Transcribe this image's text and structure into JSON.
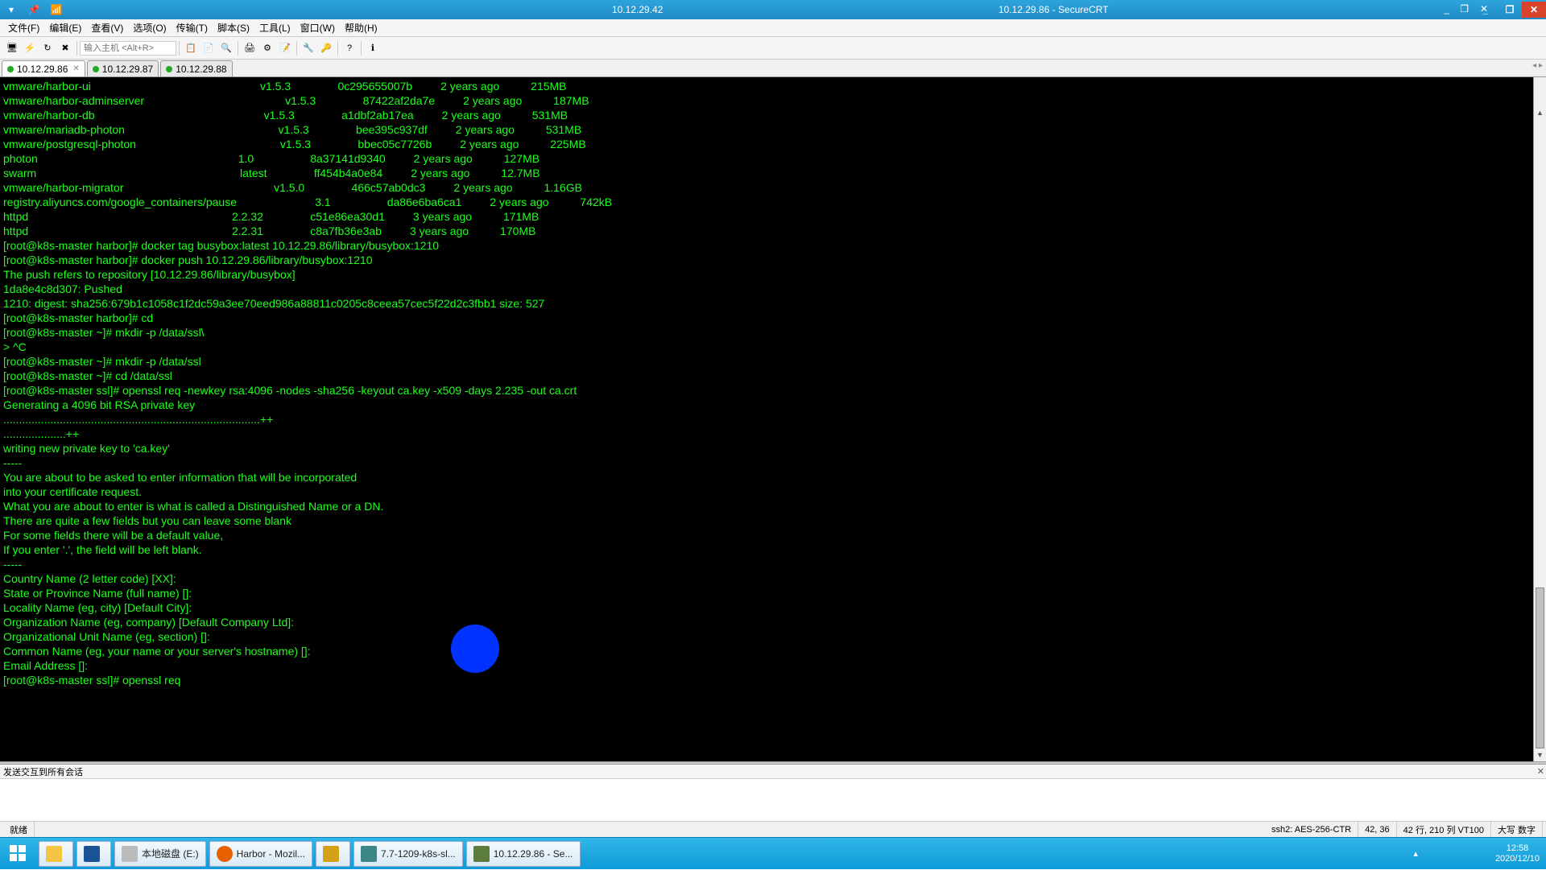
{
  "title_left": "10.12.29.42",
  "title_right": "10.12.29.86 - SecureCRT",
  "menu": [
    "文件(F)",
    "编辑(E)",
    "查看(V)",
    "选项(O)",
    "传输(T)",
    "脚本(S)",
    "工具(L)",
    "窗口(W)",
    "帮助(H)"
  ],
  "host_placeholder": "输入主机 <Alt+R>",
  "tabs": [
    {
      "label": "10.12.29.86",
      "active": true,
      "closable": true
    },
    {
      "label": "10.12.29.87",
      "active": false,
      "closable": false
    },
    {
      "label": "10.12.29.88",
      "active": false,
      "closable": false
    }
  ],
  "images": [
    {
      "name": "vmware/harbor-ui",
      "tag": "v1.5.3",
      "id": "0c295655007b",
      "age": "2 years ago",
      "size": "215MB"
    },
    {
      "name": "vmware/harbor-adminserver",
      "tag": "v1.5.3",
      "id": "87422af2da7e",
      "age": "2 years ago",
      "size": "187MB"
    },
    {
      "name": "vmware/harbor-db",
      "tag": "v1.5.3",
      "id": "a1dbf2ab17ea",
      "age": "2 years ago",
      "size": "531MB"
    },
    {
      "name": "vmware/mariadb-photon",
      "tag": "v1.5.3",
      "id": "bee395c937df",
      "age": "2 years ago",
      "size": "531MB"
    },
    {
      "name": "vmware/postgresql-photon",
      "tag": "v1.5.3",
      "id": "bbec05c7726b",
      "age": "2 years ago",
      "size": "225MB"
    },
    {
      "name": "photon",
      "tag": "1.0",
      "id": "8a37141d9340",
      "age": "2 years ago",
      "size": "127MB"
    },
    {
      "name": "swarm",
      "tag": "latest",
      "id": "ff454b4a0e84",
      "age": "2 years ago",
      "size": "12.7MB"
    },
    {
      "name": "vmware/harbor-migrator",
      "tag": "v1.5.0",
      "id": "466c57ab0dc3",
      "age": "2 years ago",
      "size": "1.16GB"
    },
    {
      "name": "registry.aliyuncs.com/google_containers/pause",
      "tag": "3.1",
      "id": "da86e6ba6ca1",
      "age": "2 years ago",
      "size": "742kB"
    },
    {
      "name": "httpd",
      "tag": "2.2.32",
      "id": "c51e86ea30d1",
      "age": "3 years ago",
      "size": "171MB"
    },
    {
      "name": "httpd",
      "tag": "2.2.31",
      "id": "c8a7fb36e3ab",
      "age": "3 years ago",
      "size": "170MB"
    }
  ],
  "lines": [
    "[root@k8s-master harbor]# docker tag busybox:latest 10.12.29.86/library/busybox:1210",
    "[root@k8s-master harbor]# docker push 10.12.29.86/library/busybox:1210",
    "The push refers to repository [10.12.29.86/library/busybox]",
    "1da8e4c8d307: Pushed",
    "1210: digest: sha256:679b1c1058c1f2dc59a3ee70eed986a88811c0205c8ceea57cec5f22d2c3fbb1 size: 527",
    "[root@k8s-master harbor]# cd",
    "[root@k8s-master ~]# mkdir -p /data/ssl\\",
    "> ^C",
    "[root@k8s-master ~]# mkdir -p /data/ssl",
    "[root@k8s-master ~]# cd /data/ssl",
    "[root@k8s-master ssl]# openssl req -newkey rsa:4096 -nodes -sha256 -keyout ca.key -x509 -days 2.235 -out ca.crt",
    "Generating a 4096 bit RSA private key",
    "..................................................................................++",
    "....................++",
    "writing new private key to 'ca.key'",
    "-----",
    "You are about to be asked to enter information that will be incorporated",
    "into your certificate request.",
    "What you are about to enter is what is called a Distinguished Name or a DN.",
    "There are quite a few fields but you can leave some blank",
    "For some fields there will be a default value,",
    "If you enter '.', the field will be left blank.",
    "-----",
    "Country Name (2 letter code) [XX]:",
    "State or Province Name (full name) []:",
    "Locality Name (eg, city) [Default City]:",
    "Organization Name (eg, company) [Default Company Ltd]:",
    "Organizational Unit Name (eg, section) []:",
    "Common Name (eg, your name or your server's hostname) []:",
    "Email Address []:",
    "[root@k8s-master ssl]# openssl req"
  ],
  "panel_title": "发送交互到所有会话",
  "status": {
    "ready": "就绪",
    "ssh": "ssh2: AES-256-CTR",
    "pos": "42, 36",
    "rows": "42 行, 210 列 VT100",
    "caps": "大写 数字"
  },
  "task": {
    "start": "⊞",
    "items": [
      {
        "label": "本地磁盘 (E:)"
      },
      {
        "label": "Harbor - Mozil..."
      },
      {
        "label": "7.7-1209-k8s-sl..."
      },
      {
        "label": "10.12.29.86 - Se..."
      }
    ],
    "time": "12:58",
    "date": "2020/12/10"
  }
}
